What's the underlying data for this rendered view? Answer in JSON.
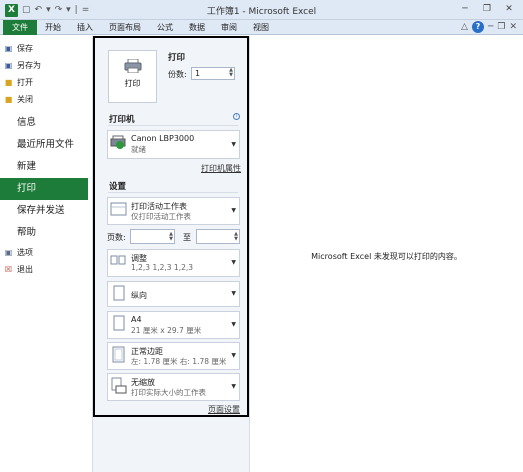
{
  "window": {
    "title": "工作簿1 - Microsoft Excel",
    "qat_symbols": [
      "▾",
      "|",
      "="
    ]
  },
  "ribbon": {
    "tabs": [
      "文件",
      "开始",
      "插入",
      "页面布局",
      "公式",
      "数据",
      "审阅",
      "视图"
    ]
  },
  "backstage_nav": {
    "save": "保存",
    "save_as": "另存为",
    "open": "打开",
    "close": "关闭",
    "info": "信息",
    "recent": "最近所用文件",
    "new": "新建",
    "print": "打印",
    "save_send": "保存并发送",
    "help": "帮助",
    "options": "选项",
    "exit": "退出"
  },
  "print_panel": {
    "print_button": "打印",
    "print_title": "打印",
    "copies_label": "份数:",
    "copies_value": "1",
    "printer_title": "打印机",
    "printer_name": "Canon LBP3000",
    "printer_status": "就绪",
    "printer_properties": "打印机属性",
    "settings_title": "设置",
    "what_to_print": "打印活动工作表",
    "what_to_print_desc": "仅打印活动工作表",
    "pages_label": "页数:",
    "to_label": "至",
    "collate": "调整",
    "collate_desc": "1,2,3    1,2,3    1,2,3",
    "orientation": "纵向",
    "paper_size": "A4",
    "paper_size_desc": "21 厘米 x 29.7 厘米",
    "margins": "正常边距",
    "margins_desc": "左: 1.78 厘米    右: 1.78 厘米",
    "scaling": "无缩放",
    "scaling_desc": "打印实际大小的工作表",
    "page_setup": "页面设置"
  },
  "preview": {
    "message": "Microsoft Excel 未发现可以打印的内容。"
  }
}
